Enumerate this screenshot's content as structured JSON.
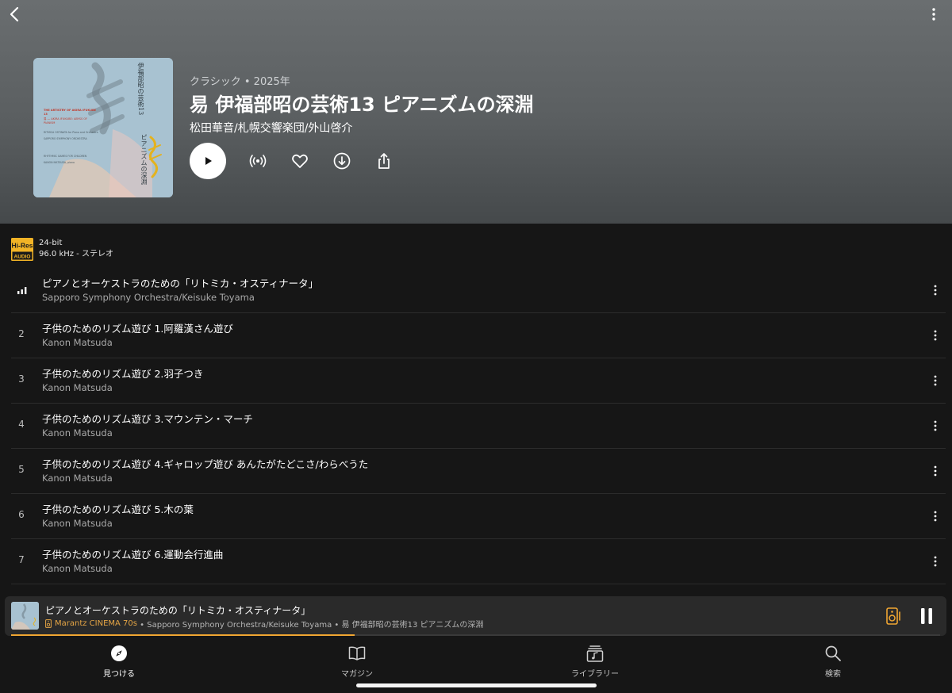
{
  "header": {
    "genre_year": "クラシック • 2025年",
    "album_title": "易 伊福部昭の芸術13 ピアニズムの深淵",
    "album_artist": "松田華音/札幌交響楽団/外山啓介"
  },
  "cover": {
    "vertical_title": "伊福部昭の芸術13",
    "vertical_subtitle": "ピアニズムの深淵",
    "english_title": "THE ARTISTRY OF AKIRA IFUKUBE 13",
    "english_sub": "易 — AKIRA IFUKUBE: ABYSS OF PIANISM",
    "credit_1": "RITMICA OSTINATA for Piano and Orchestra",
    "credit_2": "SAPPORO SYMPHONY ORCHESTRA",
    "credit_3": "RHYTHMIC GAMES FOR CHILDREN",
    "credit_4": "KANON MATSUDA, piano"
  },
  "quality": {
    "badge_top": "Hi-Res",
    "badge_bottom": "AUDIO",
    "bit_depth": "24-bit",
    "sample_rate": "96.0 kHz - ステレオ"
  },
  "tracks": [
    {
      "num": "",
      "playing": true,
      "title": "ピアノとオーケストラのための「リトミカ・オスティナータ」",
      "artist": "Sapporo Symphony Orchestra/Keisuke Toyama"
    },
    {
      "num": "2",
      "title": "子供のためのリズム遊び 1.阿羅漢さん遊び",
      "artist": "Kanon Matsuda"
    },
    {
      "num": "3",
      "title": "子供のためのリズム遊び 2.羽子つき",
      "artist": "Kanon Matsuda"
    },
    {
      "num": "4",
      "title": "子供のためのリズム遊び 3.マウンテン・マーチ",
      "artist": "Kanon Matsuda"
    },
    {
      "num": "5",
      "title": "子供のためのリズム遊び 4.ギャロップ遊び あんたがたどこさ/わらべうた",
      "artist": "Kanon Matsuda"
    },
    {
      "num": "6",
      "title": "子供のためのリズム遊び 5.木の葉",
      "artist": "Kanon Matsuda"
    },
    {
      "num": "7",
      "title": "子供のためのリズム遊び 6.運動会行進曲",
      "artist": "Kanon Matsuda"
    }
  ],
  "mini_player": {
    "title": "ピアノとオーケストラのための「リトミカ・オスティナータ」",
    "device": "Marantz CINEMA 70s",
    "subtitle": " • Sapporo Symphony Orchestra/Keisuke Toyama • 易 伊福部昭の芸術13 ピアニズムの深淵",
    "progress": 0.37
  },
  "tabs": {
    "discover": "見つける",
    "magazine": "マガジン",
    "library": "ライブラリー",
    "search": "検索"
  },
  "colors": {
    "accent": "#f0a632",
    "background": "#161616",
    "header_top": "#6a6e70"
  }
}
